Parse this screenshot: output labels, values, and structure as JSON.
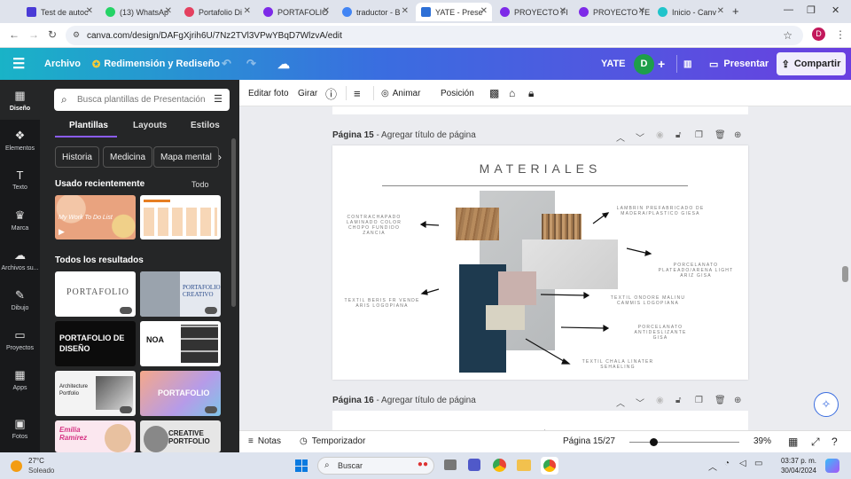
{
  "browser": {
    "tabs": [
      {
        "title": "Test de autoc",
        "color": "#4a3bd6",
        "active": false
      },
      {
        "title": "(13) WhatsAp",
        "color": "#25d366",
        "active": false
      },
      {
        "title": "Portafolio Di",
        "color": "#e4405f",
        "active": false
      },
      {
        "title": "PORTAFOLIO",
        "color": "#7d2ae8",
        "active": false
      },
      {
        "title": "traductor - B",
        "color": "#4285f4",
        "active": false
      },
      {
        "title": "YATE - Prese",
        "color": "#2d6fd6",
        "active": true
      },
      {
        "title": "PROYECTO FI",
        "color": "#7d2ae8",
        "active": false
      },
      {
        "title": "PROYECTO TE",
        "color": "#7d2ae8",
        "active": false
      },
      {
        "title": "Inicio - Canv",
        "color": "#20c4cb",
        "active": false
      }
    ],
    "new_tab": "+",
    "url": "canva.com/design/DAFgXjrih6U/7Nz2TVl3VPwYBqD7WlzvA/edit",
    "profile_initial": "D"
  },
  "canva_header": {
    "menu_icon": "hamburger-icon",
    "archivo": "Archivo",
    "title": "Redimensión y Rediseño",
    "design_name": "YATE",
    "avatar": "D",
    "presentar": "Presentar",
    "compartir": "Compartir"
  },
  "rail": {
    "items": [
      {
        "label": "Diseño",
        "icon": "▦"
      },
      {
        "label": "Elementos",
        "icon": "❖"
      },
      {
        "label": "Texto",
        "icon": "T"
      },
      {
        "label": "Marca",
        "icon": "♛"
      },
      {
        "label": "Archivos su...",
        "icon": "☁"
      },
      {
        "label": "Dibujo",
        "icon": "✎"
      },
      {
        "label": "Proyectos",
        "icon": "▭"
      },
      {
        "label": "Apps",
        "icon": "▦"
      },
      {
        "label": "Fotos",
        "icon": "▣"
      }
    ]
  },
  "panel": {
    "search_placeholder": "Busca plantillas de Presentación",
    "tabs": [
      "Plantillas",
      "Layouts",
      "Estilos"
    ],
    "chips": [
      "Historia",
      "Medicina",
      "Mapa mental"
    ],
    "recent_title": "Usado recientemente",
    "recent_link": "Todo",
    "results_title": "Todos los resultados",
    "thumbs": {
      "t1": "My Work To Do List",
      "t3": "PORTAFOLIO",
      "t4": "PORTAFOLIO CREATIVO",
      "t5": "PORTAFOLIO DE DISEÑO",
      "t6": "NOA",
      "t7": "Architecture Portfolio",
      "t8": "PORTAFOLIO",
      "t9": "Emilia Ramirez",
      "t10": "CREATIVE PORTFOLIO"
    }
  },
  "toolbar": {
    "editar_foto": "Editar foto",
    "girar": "Girar",
    "animar": "Animar",
    "posicion": "Posición"
  },
  "pages": {
    "page15_label": "Página 15",
    "page15_title": "Agregar título de página",
    "page16_label": "Página 16",
    "page16_title": "Agregar título de página"
  },
  "slide": {
    "title": "MATERIALES",
    "labels": {
      "l1": "CONTRACHAPADO LAMINADO COLOR CHOPO FUNDIDO ZANCIA",
      "l2": "LAMBRIN PREFABRICADO DE MADERA/PLASTICO GIESA",
      "l3": "PORCELANATO PLATEADO/ARENA LIGHT ARIZ GISA",
      "l4": "TEXTIL BERIS FR VENDE ARIS LOGOPIANA",
      "l5": "TEXTIL ONDORE MALINU CAMMIS LOGOPIANA",
      "l6": "PORCELANATO ANTIDESLIZANTE GISA",
      "l7": "TEXTIL CHALA LINATER SEHAELING"
    }
  },
  "bottom": {
    "notas": "Notas",
    "temporizador": "Temporizador",
    "page_indicator": "Página 15/27",
    "zoom_percent": 39,
    "zoom_label": "39%"
  },
  "taskbar": {
    "weather_temp": "27°C",
    "weather_desc": "Soleado",
    "search": "Buscar",
    "time": "03:37 p. m.",
    "date": "30/04/2024"
  }
}
